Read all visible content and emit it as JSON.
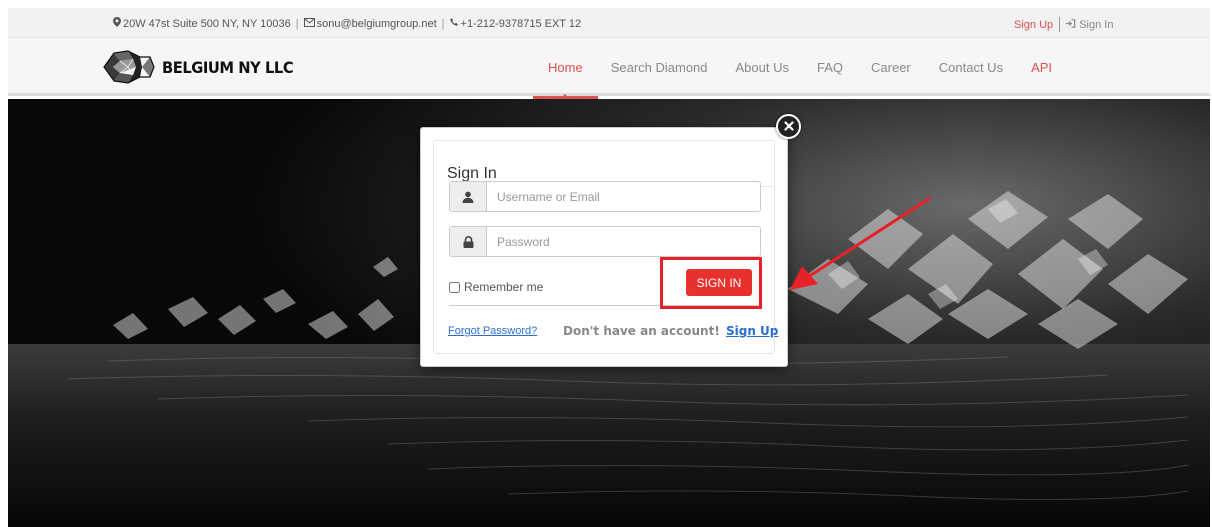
{
  "topbar": {
    "address": "20W 47st Suite 500 NY, NY 10036",
    "email": "sonu@belgiumgroup.net",
    "phone": "+1-212-9378715 EXT 12",
    "signup": "Sign Up",
    "signin": "Sign In"
  },
  "brand": {
    "name": "BELGIUM NY LLC"
  },
  "nav": {
    "items": [
      {
        "label": "Home",
        "active": true
      },
      {
        "label": "Search Diamond"
      },
      {
        "label": "About Us"
      },
      {
        "label": "FAQ"
      },
      {
        "label": "Career"
      },
      {
        "label": "Contact Us"
      },
      {
        "label": "API"
      }
    ]
  },
  "modal": {
    "title": "Sign In",
    "username_placeholder": "Username or Email",
    "password_placeholder": "Password",
    "remember_label": "Remember me",
    "submit_label": "SIGN IN",
    "forgot_label": "Forgot Password?",
    "no_account_text": "Don't have an account!",
    "signup_label": "Sign Up"
  },
  "icons": {
    "address": "map-marker-icon",
    "email": "envelope-icon",
    "phone": "phone-icon",
    "signin": "sign-in-icon",
    "username": "user-icon",
    "password": "lock-icon",
    "close": "close-icon"
  },
  "colors": {
    "accent": "#d9534f",
    "button": "#e8302f",
    "link": "#2a6fcf",
    "highlight": "#e8202a"
  }
}
